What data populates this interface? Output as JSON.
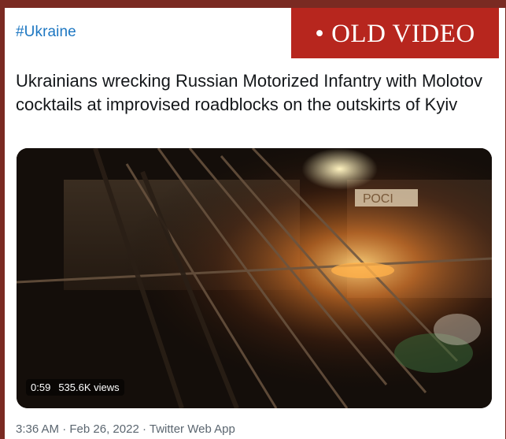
{
  "tweet": {
    "hashtag": "#Ukraine",
    "text": "Ukrainians wrecking Russian Motorized Infantry with Molotov cocktails at improvised roadblocks on the outskirts of Kyiv",
    "time": "3:36 AM",
    "sep1": "·",
    "date": "Feb 26, 2022",
    "sep2": "·",
    "source": "Twitter Web App"
  },
  "overlay_label": {
    "text": "• OLD VIDEO",
    "color": "#b7261e"
  },
  "video": {
    "duration": "0:59",
    "views": "535.6K views",
    "sign_text": "РОСІ"
  },
  "colors": {
    "frame": "#7a2a22",
    "hashtag": "#1d77c2",
    "text": "#14171a",
    "meta": "#5b6670"
  }
}
